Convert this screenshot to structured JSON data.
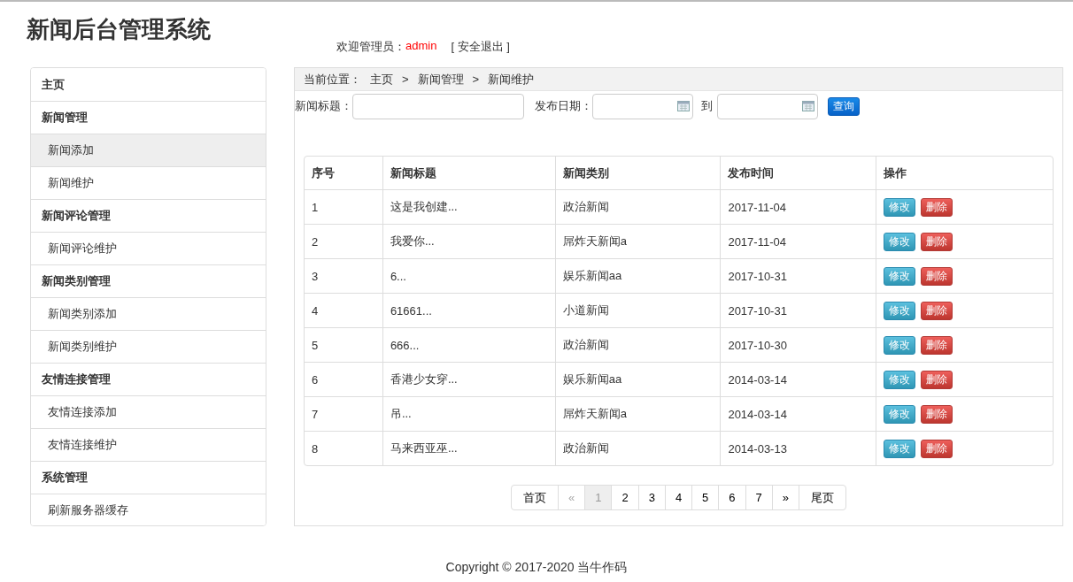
{
  "header": {
    "title": "新闻后台管理系统",
    "welcome_label": "欢迎管理员：",
    "username": "admin",
    "logout": "[ 安全退出 ]"
  },
  "sidebar": {
    "items": [
      {
        "kind": "group",
        "label": "主页",
        "selected": false
      },
      {
        "kind": "group",
        "label": "新闻管理",
        "selected": false
      },
      {
        "kind": "link",
        "label": "新闻添加",
        "selected": true
      },
      {
        "kind": "link",
        "label": "新闻维护",
        "selected": false
      },
      {
        "kind": "group",
        "label": "新闻评论管理",
        "selected": false
      },
      {
        "kind": "link",
        "label": "新闻评论维护",
        "selected": false
      },
      {
        "kind": "group",
        "label": "新闻类别管理",
        "selected": false
      },
      {
        "kind": "link",
        "label": "新闻类别添加",
        "selected": false
      },
      {
        "kind": "link",
        "label": "新闻类别维护",
        "selected": false
      },
      {
        "kind": "group",
        "label": "友情连接管理",
        "selected": false
      },
      {
        "kind": "link",
        "label": "友情连接添加",
        "selected": false
      },
      {
        "kind": "link",
        "label": "友情连接维护",
        "selected": false
      },
      {
        "kind": "group",
        "label": "系统管理",
        "selected": false
      },
      {
        "kind": "link",
        "label": "刷新服务器缓存",
        "selected": false
      }
    ]
  },
  "breadcrumb": {
    "label": "当前位置：",
    "items": [
      "主页",
      "新闻管理",
      "新闻维护"
    ],
    "separator": ">"
  },
  "filters": {
    "title_label": "新闻标题：",
    "date_label": "发布日期：",
    "to_label": "到",
    "search_button": "查询"
  },
  "table": {
    "columns": [
      "序号",
      "新闻标题",
      "新闻类别",
      "发布时间",
      "操作"
    ],
    "rows": [
      {
        "cells": [
          "1",
          "这是我创建...",
          "政治新闻",
          "2017-11-04"
        ],
        "edit": "修改",
        "delete": "删除"
      },
      {
        "cells": [
          "2",
          "我爱你...",
          "屌炸天新闻a",
          "2017-11-04"
        ],
        "edit": "修改",
        "delete": "删除"
      },
      {
        "cells": [
          "3",
          "6...",
          "娱乐新闻aa",
          "2017-10-31"
        ],
        "edit": "修改",
        "delete": "删除"
      },
      {
        "cells": [
          "4",
          "61661...",
          "小道新闻",
          "2017-10-31"
        ],
        "edit": "修改",
        "delete": "删除"
      },
      {
        "cells": [
          "5",
          "666...",
          "政治新闻",
          "2017-10-30"
        ],
        "edit": "修改",
        "delete": "删除"
      },
      {
        "cells": [
          "6",
          "香港少女穿...",
          "娱乐新闻aa",
          "2014-03-14"
        ],
        "edit": "修改",
        "delete": "删除"
      },
      {
        "cells": [
          "7",
          "吊...",
          "屌炸天新闻a",
          "2014-03-14"
        ],
        "edit": "修改",
        "delete": "删除"
      },
      {
        "cells": [
          "8",
          "马来西亚巫...",
          "政治新闻",
          "2014-03-13"
        ],
        "edit": "修改",
        "delete": "删除"
      }
    ]
  },
  "pagination": [
    {
      "label": "首页",
      "selected": false,
      "disabled": false
    },
    {
      "label": "«",
      "selected": false,
      "disabled": true
    },
    {
      "label": "1",
      "selected": true,
      "disabled": false
    },
    {
      "label": "2",
      "selected": false,
      "disabled": false
    },
    {
      "label": "3",
      "selected": false,
      "disabled": false
    },
    {
      "label": "4",
      "selected": false,
      "disabled": false
    },
    {
      "label": "5",
      "selected": false,
      "disabled": false
    },
    {
      "label": "6",
      "selected": false,
      "disabled": false
    },
    {
      "label": "7",
      "selected": false,
      "disabled": false
    },
    {
      "label": "»",
      "selected": false,
      "disabled": false
    },
    {
      "label": "尾页",
      "selected": false,
      "disabled": false
    }
  ],
  "footer": "Copyright © 2017-2020 当牛作码"
}
